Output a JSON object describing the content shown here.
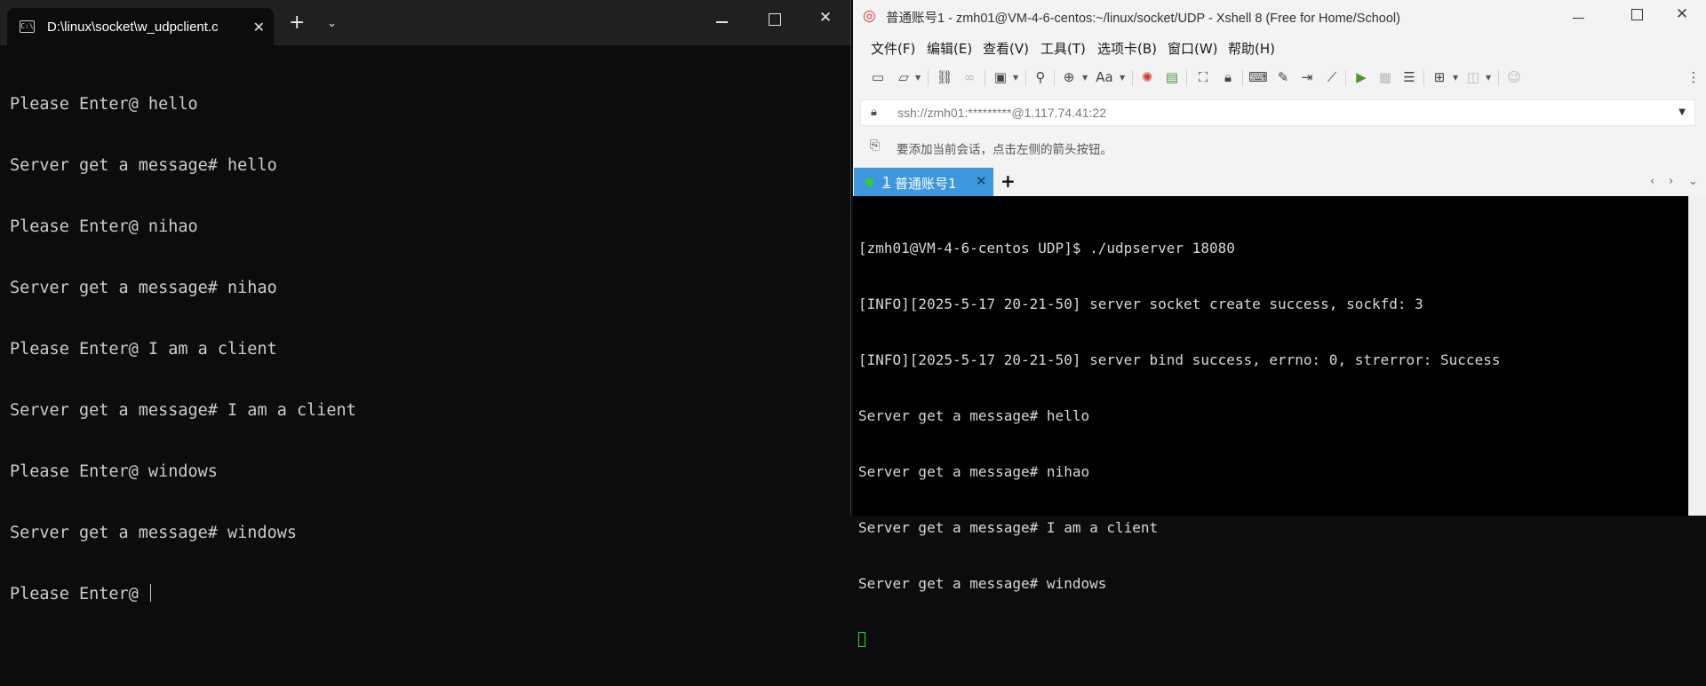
{
  "windows_terminal": {
    "tab_title": "D:\\linux\\socket\\w_udpclient.c",
    "cmd_icon_text": "C:\\",
    "new_tab_glyph": "+",
    "dropdown_glyph": "⌄",
    "close_glyph": "✕",
    "lines": [
      "Please Enter@ hello",
      "Server get a message# hello",
      "Please Enter@ nihao",
      "Server get a message# nihao",
      "Please Enter@ I am a client",
      "Server get a message# I am a client",
      "Please Enter@ windows",
      "Server get a message# windows"
    ],
    "prompt_line": "Please Enter@ "
  },
  "xshell": {
    "window_title": "普通账号1 - zmh01@VM-4-6-centos:~/linux/socket/UDP - Xshell 8 (Free for Home/School)",
    "menu": [
      "文件(F)",
      "编辑(E)",
      "查看(V)",
      "工具(T)",
      "选项卡(B)",
      "窗口(W)",
      "帮助(H)"
    ],
    "toolbar_font_label": "Aa",
    "address": "ssh://zmh01:*********@1.117.74.41:22",
    "hint": "要添加当前会话，点击左侧的箭头按钮。",
    "tab": {
      "number": "1",
      "label": " 普通账号1",
      "close_glyph": "✕",
      "status_color": "#32d02c"
    },
    "add_tab_glyph": "+",
    "terminal_lines": [
      "[zmh01@VM-4-6-centos UDP]$ ./udpserver 18080",
      "[INFO][2025-5-17 20-21-50] server socket create success, sockfd: 3",
      "[INFO][2025-5-17 20-21-50] server bind success, errno: 0, strerror: Success",
      "Server get a message# hello",
      "Server get a message# nihao",
      "Server get a message# I am a client",
      "Server get a message# windows"
    ]
  },
  "colors": {
    "wt_background": "#0c0c0c",
    "xshell_tab_accent": "#3d97dc",
    "xshell_cursor": "#2ee02e"
  }
}
